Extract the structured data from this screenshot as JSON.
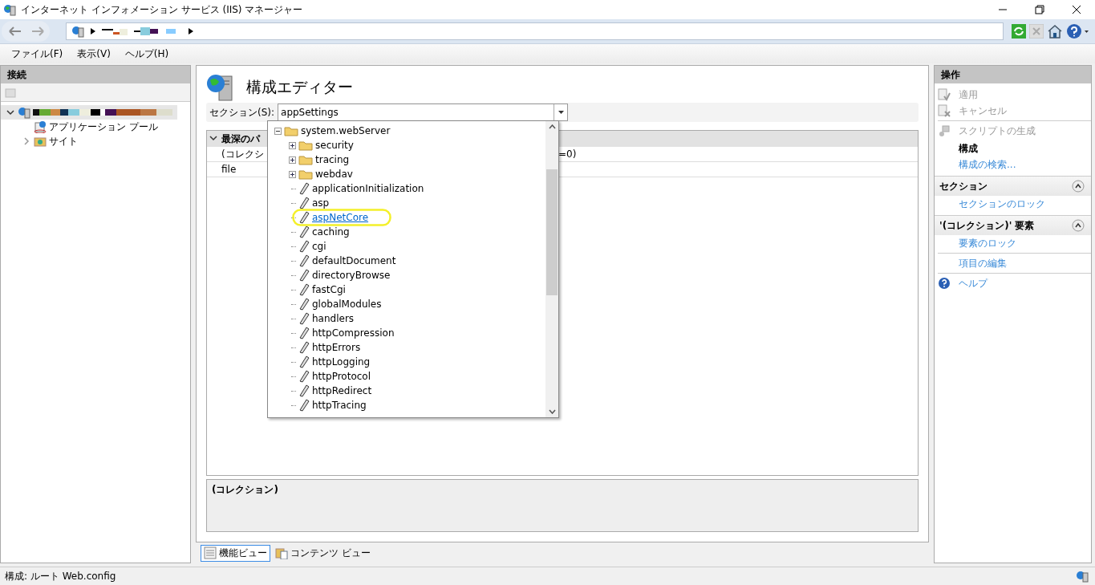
{
  "window": {
    "title": "インターネット インフォメーション サービス (IIS) マネージャー"
  },
  "menu": [
    {
      "label": "ファイル(F)"
    },
    {
      "label": "表示(V)"
    },
    {
      "label": "ヘルプ(H)"
    }
  ],
  "connections": {
    "title": "接続",
    "tree": [
      {
        "kind": "server",
        "expanded": true,
        "selected": true,
        "children": [
          {
            "kind": "pool",
            "label": "アプリケーション プール",
            "expanded": false,
            "selected": false
          },
          {
            "kind": "sites",
            "label": "サイト",
            "expanded": false,
            "selected": false
          }
        ]
      }
    ]
  },
  "editor": {
    "title": "構成エディター",
    "section_label": "セクション(S):",
    "section_value": "appSettings",
    "dropdown": [
      {
        "label": "system.webServer",
        "kind": "folder",
        "expanded": true,
        "children": [
          {
            "label": "security",
            "kind": "folder",
            "expanded": false
          },
          {
            "label": "tracing",
            "kind": "folder",
            "expanded": false
          },
          {
            "label": "webdav",
            "kind": "folder",
            "expanded": false
          },
          {
            "label": "applicationInitialization",
            "kind": "section",
            "hovered": false
          },
          {
            "label": "asp",
            "kind": "section",
            "hovered": false
          },
          {
            "label": "aspNetCore",
            "kind": "section",
            "hovered": true
          },
          {
            "label": "caching",
            "kind": "section",
            "hovered": false
          },
          {
            "label": "cgi",
            "kind": "section",
            "hovered": false
          },
          {
            "label": "defaultDocument",
            "kind": "section",
            "hovered": false
          },
          {
            "label": "directoryBrowse",
            "kind": "section",
            "hovered": false
          },
          {
            "label": "fastCgi",
            "kind": "section",
            "hovered": false
          },
          {
            "label": "globalModules",
            "kind": "section",
            "hovered": false
          },
          {
            "label": "handlers",
            "kind": "section",
            "hovered": false
          },
          {
            "label": "httpCompression",
            "kind": "section",
            "hovered": false
          },
          {
            "label": "httpErrors",
            "kind": "section",
            "hovered": false
          },
          {
            "label": "httpLogging",
            "kind": "section",
            "hovered": false
          },
          {
            "label": "httpProtocol",
            "kind": "section",
            "hovered": false
          },
          {
            "label": "httpRedirect",
            "kind": "section",
            "hovered": false
          },
          {
            "label": "httpTracing",
            "kind": "section",
            "hovered": false
          }
        ]
      }
    ],
    "grid": {
      "header": "最深のパ",
      "header_expanded": true,
      "rows": [
        {
          "left": "(コレクシ",
          "right": "=0)"
        },
        {
          "left": "file",
          "right": ""
        }
      ]
    },
    "detail": "(コレクション)"
  },
  "view_tabs": [
    {
      "label": "機能ビュー",
      "selected": true
    },
    {
      "label": "コンテンツ ビュー",
      "selected": false
    }
  ],
  "actions": {
    "title": "操作",
    "items": [
      {
        "kind": "action",
        "label": "適用",
        "disabled": true
      },
      {
        "kind": "action",
        "label": "キャンセル",
        "disabled": true
      },
      {
        "kind": "divider"
      },
      {
        "kind": "action",
        "label": "スクリプトの生成",
        "disabled": true
      },
      {
        "kind": "heading",
        "label": "構成"
      },
      {
        "kind": "action",
        "label": "構成の検索...",
        "disabled": false
      },
      {
        "kind": "group",
        "label": "セクション",
        "expanded": true
      },
      {
        "kind": "action",
        "label": "セクションのロック",
        "disabled": false
      },
      {
        "kind": "group",
        "label": "'(コレクション)' 要素",
        "expanded": true
      },
      {
        "kind": "action",
        "label": "要素のロック",
        "disabled": false
      },
      {
        "kind": "divider"
      },
      {
        "kind": "action",
        "label": "項目の編集",
        "disabled": false
      },
      {
        "kind": "divider"
      },
      {
        "kind": "action",
        "label": "ヘルプ",
        "disabled": false
      }
    ]
  },
  "status_bar": {
    "text": "構成: ルート Web.config"
  }
}
